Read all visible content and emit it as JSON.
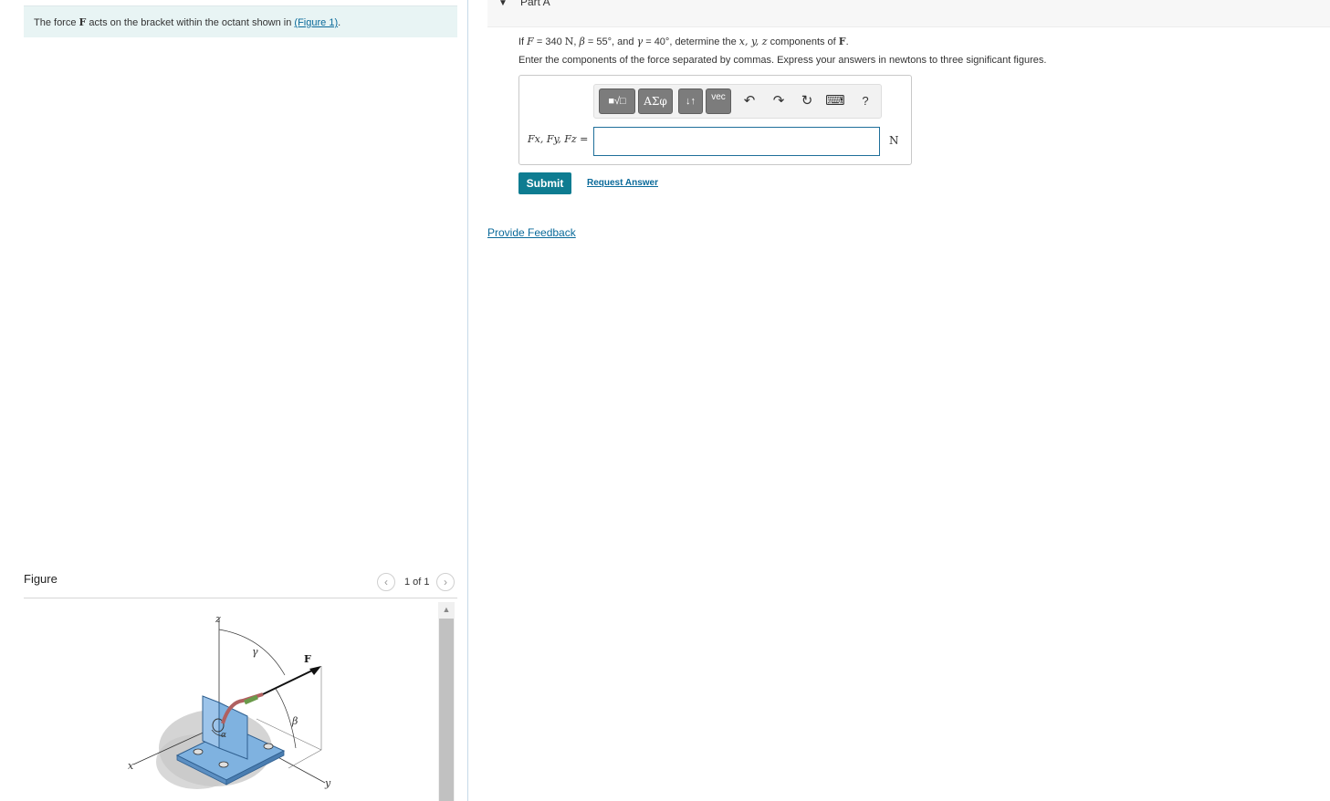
{
  "problem": {
    "intro_pre": "The force ",
    "intro_force": "F",
    "intro_mid": " acts on the bracket within the octant shown in ",
    "intro_link": "(Figure 1)",
    "intro_post": "."
  },
  "figure": {
    "title": "Figure",
    "page_indicator": "1 of 1",
    "prev_icon": "chevron-left-icon",
    "next_icon": "chevron-right-icon",
    "labels": {
      "z": "z",
      "x": "x",
      "y": "y",
      "gamma": "γ",
      "beta": "β",
      "alpha": "α",
      "force": "F"
    }
  },
  "part": {
    "title": "Part A",
    "caret_icon": "caret-down-icon"
  },
  "question": {
    "if": "If ",
    "F_sym": "F",
    "eq1": " = 340 ",
    "N": "N",
    "comma1": ", ",
    "beta_sym": "β",
    "eq2": " = 55°",
    "and": ", and ",
    "gamma_sym": "γ",
    "eq3": " = 40°",
    "determine": ", determine the ",
    "xyz": "x, y, z",
    "components_of": " components of ",
    "F_bold": "F",
    "end": "."
  },
  "instructions": "Enter the components of the force separated by commas. Express your answers in newtons to three significant figures.",
  "answer": {
    "label": "Fx, Fy, Fz =",
    "value": "",
    "unit": "N",
    "toolbar": {
      "templates": "■√□",
      "greek": "ΑΣφ",
      "arrows": "↓↑",
      "vec": "vec",
      "undo": "↶",
      "redo": "↷",
      "reset": "↻",
      "keyboard": "⌨",
      "help": "?"
    }
  },
  "buttons": {
    "submit": "Submit",
    "request_answer": "Request Answer"
  },
  "feedback": "Provide Feedback",
  "colors": {
    "accent": "#0e7c91",
    "link": "#0a6a9a",
    "intro_bg": "#e8f4f4",
    "bracket": "#7fb2e0"
  }
}
